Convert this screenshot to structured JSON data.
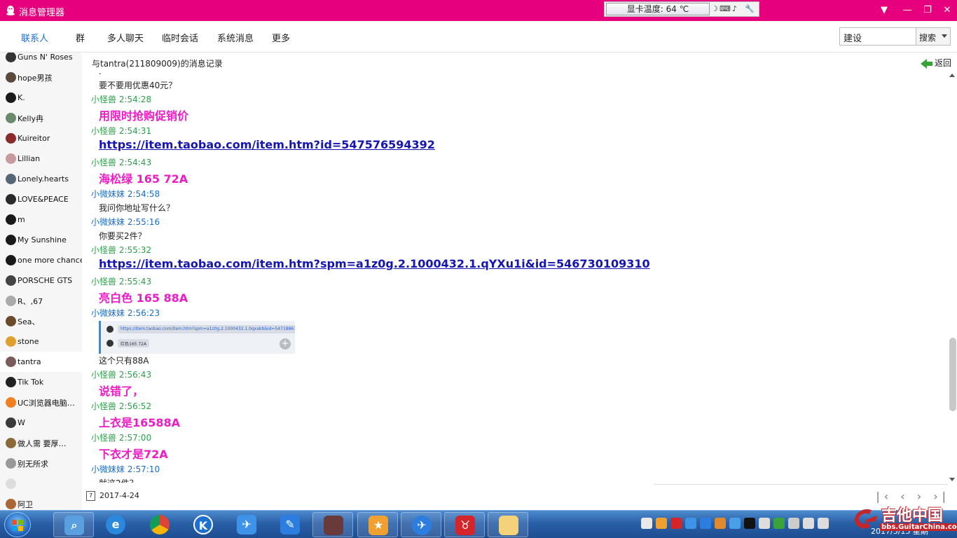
{
  "app": {
    "title": "消息管理器"
  },
  "gpu_widget": {
    "label": "显卡温度: 64 ℃"
  },
  "window_controls": {
    "minimize": "—",
    "restore": "❐",
    "close": "✕",
    "dropdown": "▼"
  },
  "nav": {
    "tabs": [
      "联系人",
      "群",
      "多人聊天",
      "临时会话",
      "系统消息",
      "更多"
    ],
    "active_tab": "联系人"
  },
  "search": {
    "value": "建设",
    "button_label": "搜索"
  },
  "sidebar": {
    "contacts": [
      {
        "name": "Guns N' Roses",
        "color": "#333333"
      },
      {
        "name": "hope男孩",
        "color": "#5a4a3a"
      },
      {
        "name": "K.",
        "color": "#1a1a1a"
      },
      {
        "name": "Kelly冉",
        "color": "#6b8a6b"
      },
      {
        "name": "Kuireitor",
        "color": "#8a2a2a"
      },
      {
        "name": "Lillian",
        "color": "#c89aa0"
      },
      {
        "name": "Lonely.hearts",
        "color": "#556677"
      },
      {
        "name": "LOVE&PEACE",
        "color": "#2a2a2a"
      },
      {
        "name": "m",
        "color": "#1a1a1a"
      },
      {
        "name": "My  Sunshine",
        "color": "#1a1a1a"
      },
      {
        "name": "one more chance",
        "color": "#1a1a1a"
      },
      {
        "name": "PORSCHE GTS",
        "color": "#444444"
      },
      {
        "name": "R、,67",
        "color": "#aaaaaa"
      },
      {
        "name": "Sea、",
        "color": "#6b4a2a"
      },
      {
        "name": "stone",
        "color": "#e0a030"
      },
      {
        "name": "tantra",
        "color": "#7a5a5a"
      },
      {
        "name": "Tik Tok",
        "color": "#222222"
      },
      {
        "name": "UC浏览器电脑…",
        "color": "#f08020"
      },
      {
        "name": "W",
        "color": "#3a3a3a"
      },
      {
        "name": "做人需   要厚…",
        "color": "#8a6a3a"
      },
      {
        "name": "别无所求",
        "color": "#999999"
      },
      {
        "name": "",
        "color": "#dddddd"
      },
      {
        "name": "阿卫",
        "color": "#aa6633"
      }
    ],
    "selected": "tantra"
  },
  "log": {
    "header": "与tantra(211809009)的消息记录",
    "back_label": "返回",
    "messages": [
      {
        "kind": "plain",
        "text": "."
      },
      {
        "kind": "plain",
        "text": "要不要用优惠40元？"
      },
      {
        "kind": "sender",
        "who": "a",
        "text": "小怪兽 2:54:28"
      },
      {
        "kind": "big",
        "text": "用限时抢购促销价"
      },
      {
        "kind": "sender",
        "who": "a",
        "text": "小怪兽 2:54:31"
      },
      {
        "kind": "link",
        "text": "https://item.taobao.com/item.htm?id=547576594392"
      },
      {
        "kind": "sender",
        "who": "a",
        "text": "小怪兽 2:54:43"
      },
      {
        "kind": "big",
        "text": "海松绿 165 72A"
      },
      {
        "kind": "sender",
        "who": "b",
        "text": "小微妹妹 2:54:58"
      },
      {
        "kind": "plain",
        "text": "我问你地址写什么？"
      },
      {
        "kind": "sender",
        "who": "b",
        "text": "小微妹妹 2:55:16"
      },
      {
        "kind": "plain",
        "text": "你要买2件？"
      },
      {
        "kind": "sender",
        "who": "a",
        "text": "小怪兽 2:55:32"
      },
      {
        "kind": "link",
        "text": "https://item.taobao.com/item.htm?spm=a1z0g.2.1000432.1.qYXu1i&id=546730109310"
      },
      {
        "kind": "sender",
        "who": "a",
        "text": "小怪兽 2:55:43"
      },
      {
        "kind": "big",
        "text": "亮白色 165 88A"
      },
      {
        "kind": "sender",
        "who": "b",
        "text": "小微妹妹 2:56:23"
      },
      {
        "kind": "image"
      },
      {
        "kind": "plain",
        "text": "这个只有88A"
      },
      {
        "kind": "sender",
        "who": "a",
        "text": "小怪兽 2:56:43"
      },
      {
        "kind": "big",
        "text": "说错了，"
      },
      {
        "kind": "sender",
        "who": "a",
        "text": "小怪兽 2:56:52"
      },
      {
        "kind": "big",
        "text": "上衣是16588A"
      },
      {
        "kind": "sender",
        "who": "a",
        "text": "小怪兽 2:57:00"
      },
      {
        "kind": "big",
        "text": "下衣才是72A"
      },
      {
        "kind": "sender",
        "who": "b",
        "text": "小微妹妹 2:57:10"
      },
      {
        "kind": "plain",
        "text": "就这2件？"
      }
    ],
    "thumbnail": {
      "link_text": "https://item.taobao.com/item.htm?spm=a1z0g.2.1000432.1.0qxakb&id=547188619827",
      "label_text": "红色165 72A"
    },
    "footer_date": "2017-4-24",
    "calendar_day": "7",
    "pager": "|‹ ‹ › ›|"
  },
  "taskbar": {
    "clock": "2017/5/15 星期"
  },
  "watermark": {
    "main": "吉他中国",
    "sub": "bbs.GuitarChina.com"
  },
  "colors": {
    "titlebar": "#e6007e",
    "sender_a": "#2e9e4a",
    "sender_b": "#1c6fc4",
    "big_text": "#ee1cc4",
    "link": "#1515b4"
  }
}
